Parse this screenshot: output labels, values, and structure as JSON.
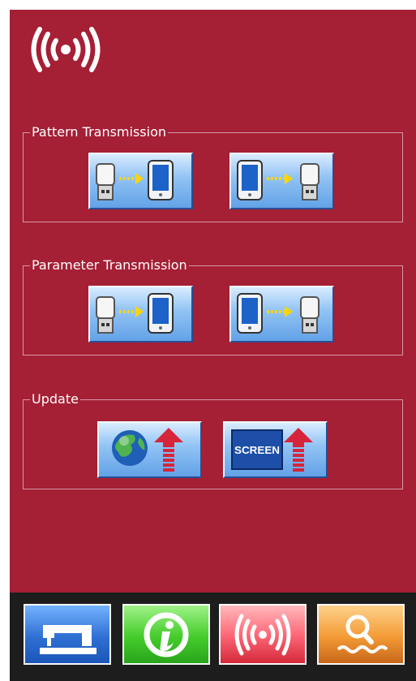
{
  "header": {
    "icon": "wireless-signal-icon"
  },
  "groups": [
    {
      "title": "Pattern Transmission",
      "buttons": [
        {
          "icon": "usb-to-device-icon"
        },
        {
          "icon": "device-to-usb-icon"
        }
      ]
    },
    {
      "title": "Parameter Transmission",
      "buttons": [
        {
          "icon": "usb-to-device-icon"
        },
        {
          "icon": "device-to-usb-icon"
        }
      ]
    },
    {
      "title": "Update",
      "buttons": [
        {
          "icon": "globe-upload-icon"
        },
        {
          "icon": "screen-upload-icon",
          "badge_label": "SCREEN"
        }
      ]
    }
  ],
  "bottom_tabs": [
    {
      "icon": "sewing-machine-icon",
      "color": "#2f6fd3"
    },
    {
      "icon": "info-icon",
      "color": "#44cc2b"
    },
    {
      "icon": "wireless-signal-icon",
      "color": "#ff6a78",
      "active": true
    },
    {
      "icon": "search-icon",
      "color": "#f39a34"
    }
  ],
  "colors": {
    "panel_bg": "#a51f35",
    "bottom_bar_bg": "#1d1d1d",
    "button_blue": "#93c4f4"
  }
}
